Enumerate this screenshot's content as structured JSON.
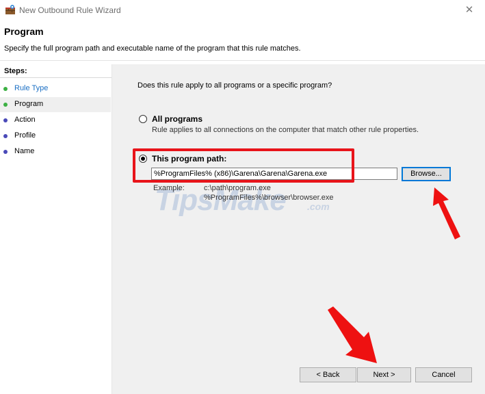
{
  "window": {
    "title": "New Outbound Rule Wizard",
    "close_glyph": "✕"
  },
  "header": {
    "title": "Program",
    "description": "Specify the full program path and executable name of the program that this rule matches."
  },
  "sidebar": {
    "heading": "Steps:",
    "items": [
      {
        "label": "Rule Type",
        "status": "complete",
        "color": "#1a6fc4"
      },
      {
        "label": "Program",
        "status": "current",
        "color": "#000000"
      },
      {
        "label": "Action",
        "status": "pending",
        "color": "#000000"
      },
      {
        "label": "Profile",
        "status": "pending",
        "color": "#000000"
      },
      {
        "label": "Name",
        "status": "pending",
        "color": "#000000"
      }
    ],
    "dot_colors": {
      "complete": "#3cb043",
      "pending": "#4a4ab8"
    }
  },
  "main": {
    "question": "Does this rule apply to all programs or a specific program?",
    "all_programs": {
      "label": "All programs",
      "description": "Rule applies to all connections on the computer that match other rule properties.",
      "selected": false
    },
    "program_path": {
      "label": "This program path:",
      "value": "%ProgramFiles% (x86)\\Garena\\Garena\\Garena.exe",
      "selected": true
    },
    "browse_label": "Browse...",
    "example_label": "Example:",
    "example_lines": [
      "c:\\path\\program.exe",
      "%ProgramFiles%\\browser\\browser.exe"
    ]
  },
  "watermark": {
    "text": "TipsMake",
    "suffix": ".com"
  },
  "footer": {
    "back_label": "< Back",
    "next_label": "Next >",
    "cancel_label": "Cancel"
  },
  "colors": {
    "highlight": "#e8141a",
    "arrow": "#ee1111",
    "panel_bg": "#f0f0f0",
    "focus": "#0078d7"
  }
}
